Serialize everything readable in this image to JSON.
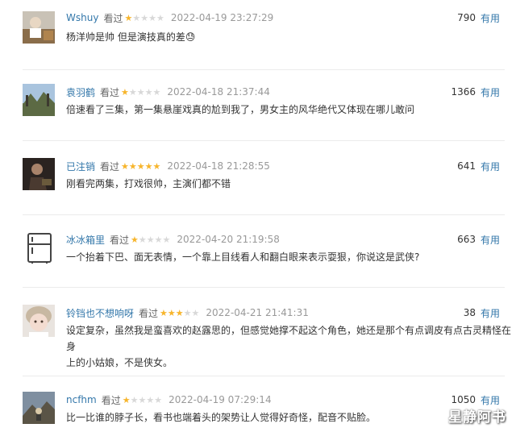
{
  "comments": [
    {
      "user": "Wshuy",
      "status": "看过",
      "rating": 1,
      "time": "2022-04-19 23:27:29",
      "votes": "790",
      "useful": "有用",
      "text": "杨洋帅是帅 但是演技真的差😓",
      "avatar": "photo-icon"
    },
    {
      "user": "袁羽鹤",
      "status": "看过",
      "rating": 1,
      "time": "2022-04-18 21:37:44",
      "votes": "1366",
      "useful": "有用",
      "text": "倍速看了三集，第一集悬崖戏真的尬到我了，男女主的风华绝代又体现在哪儿敢问",
      "avatar": "landscape-photo-icon"
    },
    {
      "user": "已注销",
      "status": "看过",
      "rating": 5,
      "time": "2022-04-18 21:28:55",
      "votes": "641",
      "useful": "有用",
      "text": "刚看完两集，打戏很帅，主演们都不错",
      "avatar": "dark-photo-icon"
    },
    {
      "user": "冰冰箱里",
      "status": "看过",
      "rating": 1,
      "time": "2022-04-20 21:19:58",
      "votes": "663",
      "useful": "有用",
      "text": "一个抬着下巴、面无表情，一个靠上目线看人和翻白眼来表示耍狠，你说这是武侠?",
      "avatar": "fridge-icon"
    },
    {
      "user": "铃铛也不想响呀",
      "status": "看过",
      "rating": 3,
      "time": "2022-04-21 21:41:31",
      "votes": "38",
      "useful": "有用",
      "text_lines": [
        "设定复杂，虽然我是蛮喜欢的赵露思的，但感觉她撑不起这个角色，她还是那个有点调皮有点古灵精怪在身",
        "上的小姑娘，不是侠女。"
      ],
      "avatar": "child-photo-icon"
    },
    {
      "user": "ncfhm",
      "status": "看过",
      "rating": 1,
      "time": "2022-04-19 07:29:14",
      "votes": "1050",
      "useful": "有用",
      "text": "比一比谁的脖子长，看书也端着头的架势让人觉得好奇怪，配音不贴脸。",
      "avatar": "mountain-photo-icon"
    }
  ],
  "watermark": "星静阿书",
  "colors": {
    "link": "#3377aa",
    "star_on": "#f7b52c",
    "star_off": "#d8d8d8",
    "meta": "#999999"
  }
}
